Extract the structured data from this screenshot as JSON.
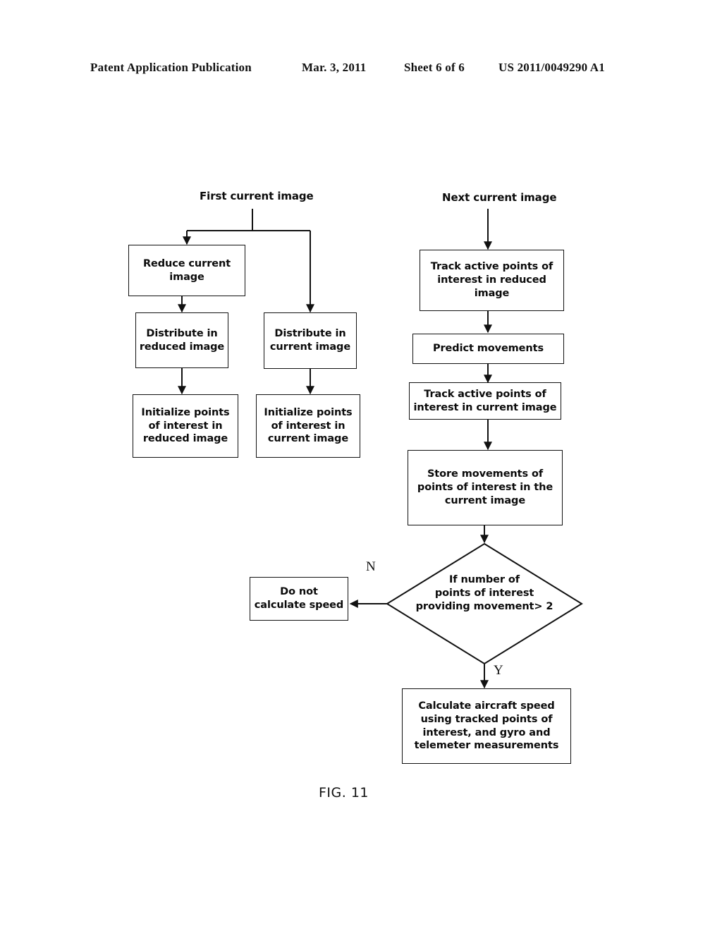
{
  "header": {
    "publication": "Patent Application Publication",
    "date": "Mar. 3, 2011",
    "sheet": "Sheet 6 of 6",
    "patent_number": "US 2011/0049290 A1"
  },
  "figure": {
    "label": "FIG. 11",
    "captions": {
      "first_current_image": "First current image",
      "next_current_image": "Next current image"
    },
    "branch_labels": {
      "no": "N",
      "yes": "Y"
    },
    "nodes": {
      "reduce_current_image": "Reduce current image",
      "distribute_reduced": "Distribute in reduced image",
      "distribute_current": "Distribute in current image",
      "initialize_reduced": "Initialize points of interest in reduced image",
      "initialize_current": "Initialize points of interest in current image",
      "track_reduced": "Track active points of interest in reduced image",
      "predict_movements": "Predict movements",
      "track_current": "Track active points of interest in current image",
      "store_movements": "Store movements of points of interest in the current image",
      "do_not_calculate": "Do not calculate speed",
      "calculate_speed": "Calculate aircraft speed using tracked points of interest, and gyro and telemeter measurements"
    },
    "decision": {
      "line1": "If number of",
      "line2": "points of interest",
      "line3": "providing movement> 2"
    },
    "colors": {
      "ink": "#111111",
      "paper": "#ffffff"
    }
  }
}
